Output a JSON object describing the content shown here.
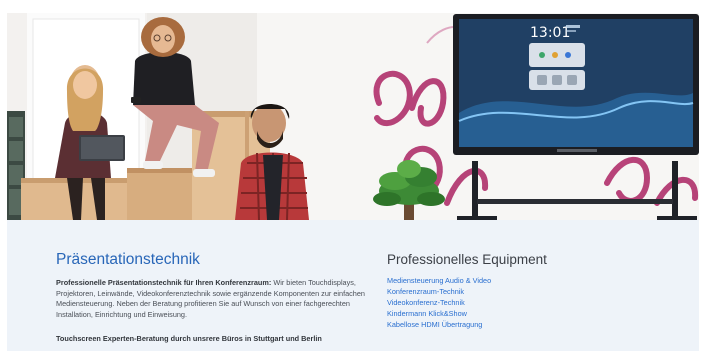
{
  "hero": {
    "alt": "",
    "display": {
      "clock": "13:01"
    }
  },
  "left": {
    "title": "Präsentationstechnik",
    "desc_bold": "Professionelle Präsentationstechnik für Ihren Konferenzraum:",
    "desc_text": " Wir bieten Touchdisplays, Projektoren, Leinwände, Videokonferenztechnik sowie ergänzende Komponenten zur einfachen Mediensteuerung. Neben der Beratung profitieren Sie auf Wunsch von einer fachgerechten Installation, Einrichtung und Einweisung.",
    "cta": "Touchscreen Experten-Beratung durch unsrere Büros in Stuttgart und Berlin"
  },
  "right": {
    "title": "Professionelles Equipment",
    "links": [
      "Mediensteuerung Audio & Video",
      "Konferenzraum-Technik",
      "Videokonferenz-Technik",
      "Kindermann Klick&Show",
      "Kabellose HDMI Übertragung"
    ]
  },
  "colors": {
    "accent": "#2866b8",
    "link": "#2a6fd0",
    "panel_bg": "#eef3f9"
  }
}
